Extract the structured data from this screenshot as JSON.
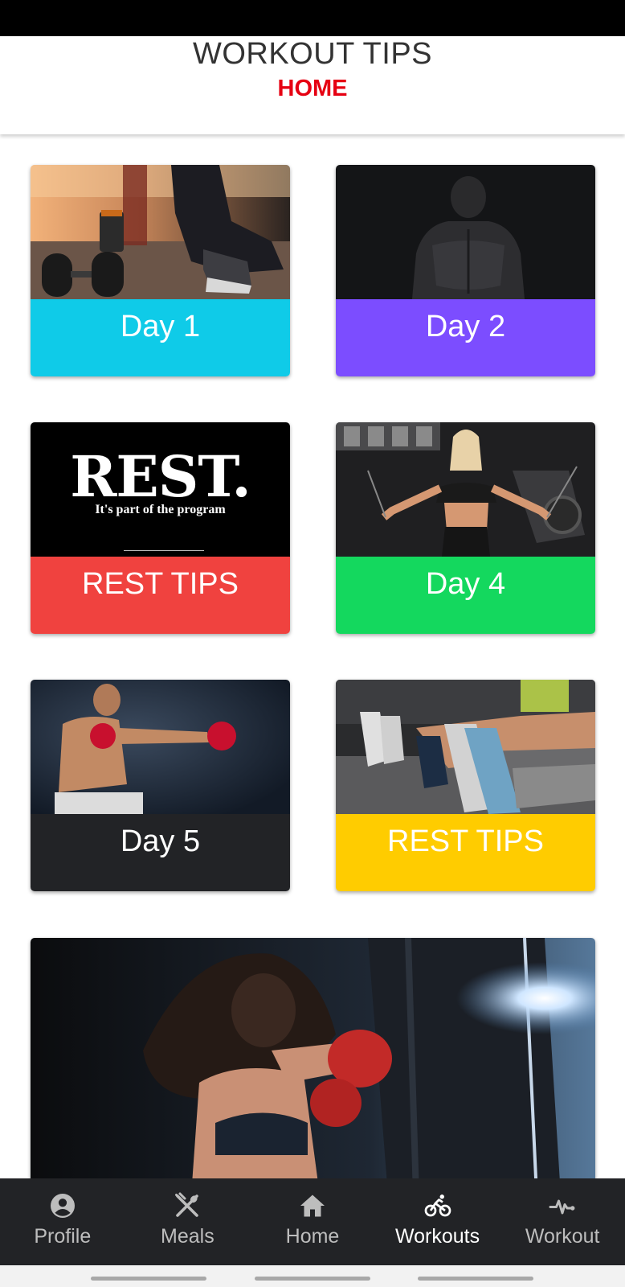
{
  "header": {
    "title": "WORKOUT TIPS",
    "subtitle": "HOME"
  },
  "cards": [
    {
      "label": "Day 1",
      "color": "#0fcbe8",
      "image": "woman-sitting-with-dumbbells-photo"
    },
    {
      "label": "Day 2",
      "color": "#7c4dff",
      "image": "muscular-back-photo"
    },
    {
      "label": "REST TIPS",
      "color": "#f0423f",
      "image": "rest-poster",
      "poster_title": "REST.",
      "poster_subtitle": "It's part of the program"
    },
    {
      "label": "Day 4",
      "color": "#14d85e",
      "image": "woman-cable-machine-photo"
    },
    {
      "label": "Day 5",
      "color": "#222326",
      "image": "boxer-punching-photo"
    },
    {
      "label": "REST TIPS",
      "color": "#ffcc00",
      "image": "legs-resting-sneakers-photo"
    }
  ],
  "banner": {
    "image": "woman-boxing-heavy-bag-photo"
  },
  "nav": {
    "items": [
      {
        "label": "Profile",
        "icon": "account-circle-icon",
        "active": false
      },
      {
        "label": "Meals",
        "icon": "fork-knife-icon",
        "active": false
      },
      {
        "label": "Home",
        "icon": "home-icon",
        "active": false
      },
      {
        "label": "Workouts",
        "icon": "bicycle-icon",
        "active": true
      },
      {
        "label": "Workout",
        "icon": "heart-pulse-icon",
        "active": false
      }
    ]
  }
}
